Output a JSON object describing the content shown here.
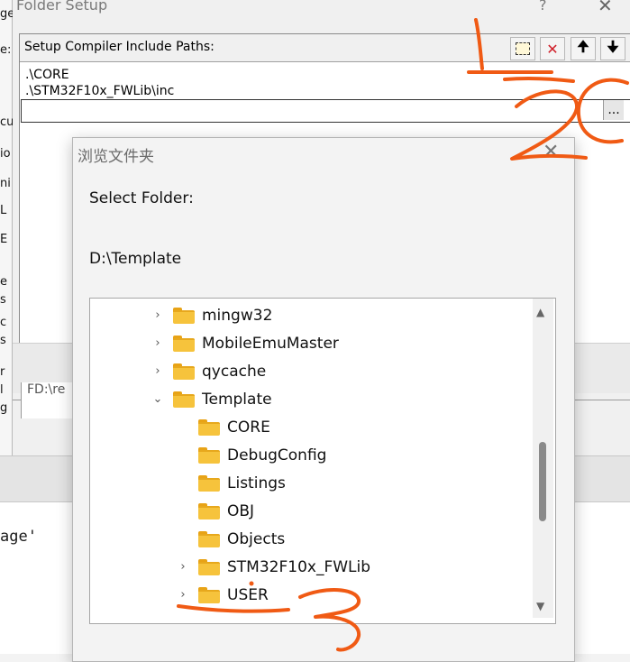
{
  "folder_setup": {
    "title": "Folder Setup",
    "help_label": "?",
    "close_label": "✕",
    "header_label": "Setup Compiler Include Paths:",
    "toolbar": {
      "new_icon": "new-folder-icon",
      "delete_icon": "delete-icon",
      "up_icon": "move-up-icon",
      "down_icon": "move-down-icon",
      "delete_symbol": "✕",
      "up_symbol": "🠉",
      "down_symbol": "🠋"
    },
    "paths": [
      ".\\CORE",
      ".\\STM32F10x_FWLib\\inc"
    ],
    "edit_value": "",
    "browse_label": "...",
    "bottom_fragment": "FD:\\re"
  },
  "left_fragments": [
    "ge",
    "e:",
    "cu",
    "io",
    "ni",
    "L",
    "E",
    "e",
    "s",
    "c",
    "s",
    "r",
    "l",
    "g"
  ],
  "background_code": "age'",
  "browse_dialog": {
    "title": "浏览文件夹",
    "close_label": "✕",
    "select_label": "Select Folder:",
    "current_path": "D:\\Template",
    "tree": [
      {
        "label": "mingw32",
        "expander": "›",
        "indent": 1
      },
      {
        "label": "MobileEmuMaster",
        "expander": "›",
        "indent": 1
      },
      {
        "label": "qycache",
        "expander": "›",
        "indent": 1
      },
      {
        "label": "Template",
        "expander": "⌄",
        "indent": 1
      },
      {
        "label": "CORE",
        "expander": "",
        "indent": 2
      },
      {
        "label": "DebugConfig",
        "expander": "",
        "indent": 2
      },
      {
        "label": "Listings",
        "expander": "",
        "indent": 2
      },
      {
        "label": "OBJ",
        "expander": "",
        "indent": 2
      },
      {
        "label": "Objects",
        "expander": "",
        "indent": 2
      },
      {
        "label": "STM32F10x_FWLib",
        "expander": "›",
        "indent": 2
      },
      {
        "label": "USER",
        "expander": "›",
        "indent": 2
      }
    ],
    "scroll_up": "▲",
    "scroll_down": "▼"
  },
  "annotations": {
    "color": "#f05a14",
    "marks": [
      "1",
      "2",
      "3"
    ]
  }
}
